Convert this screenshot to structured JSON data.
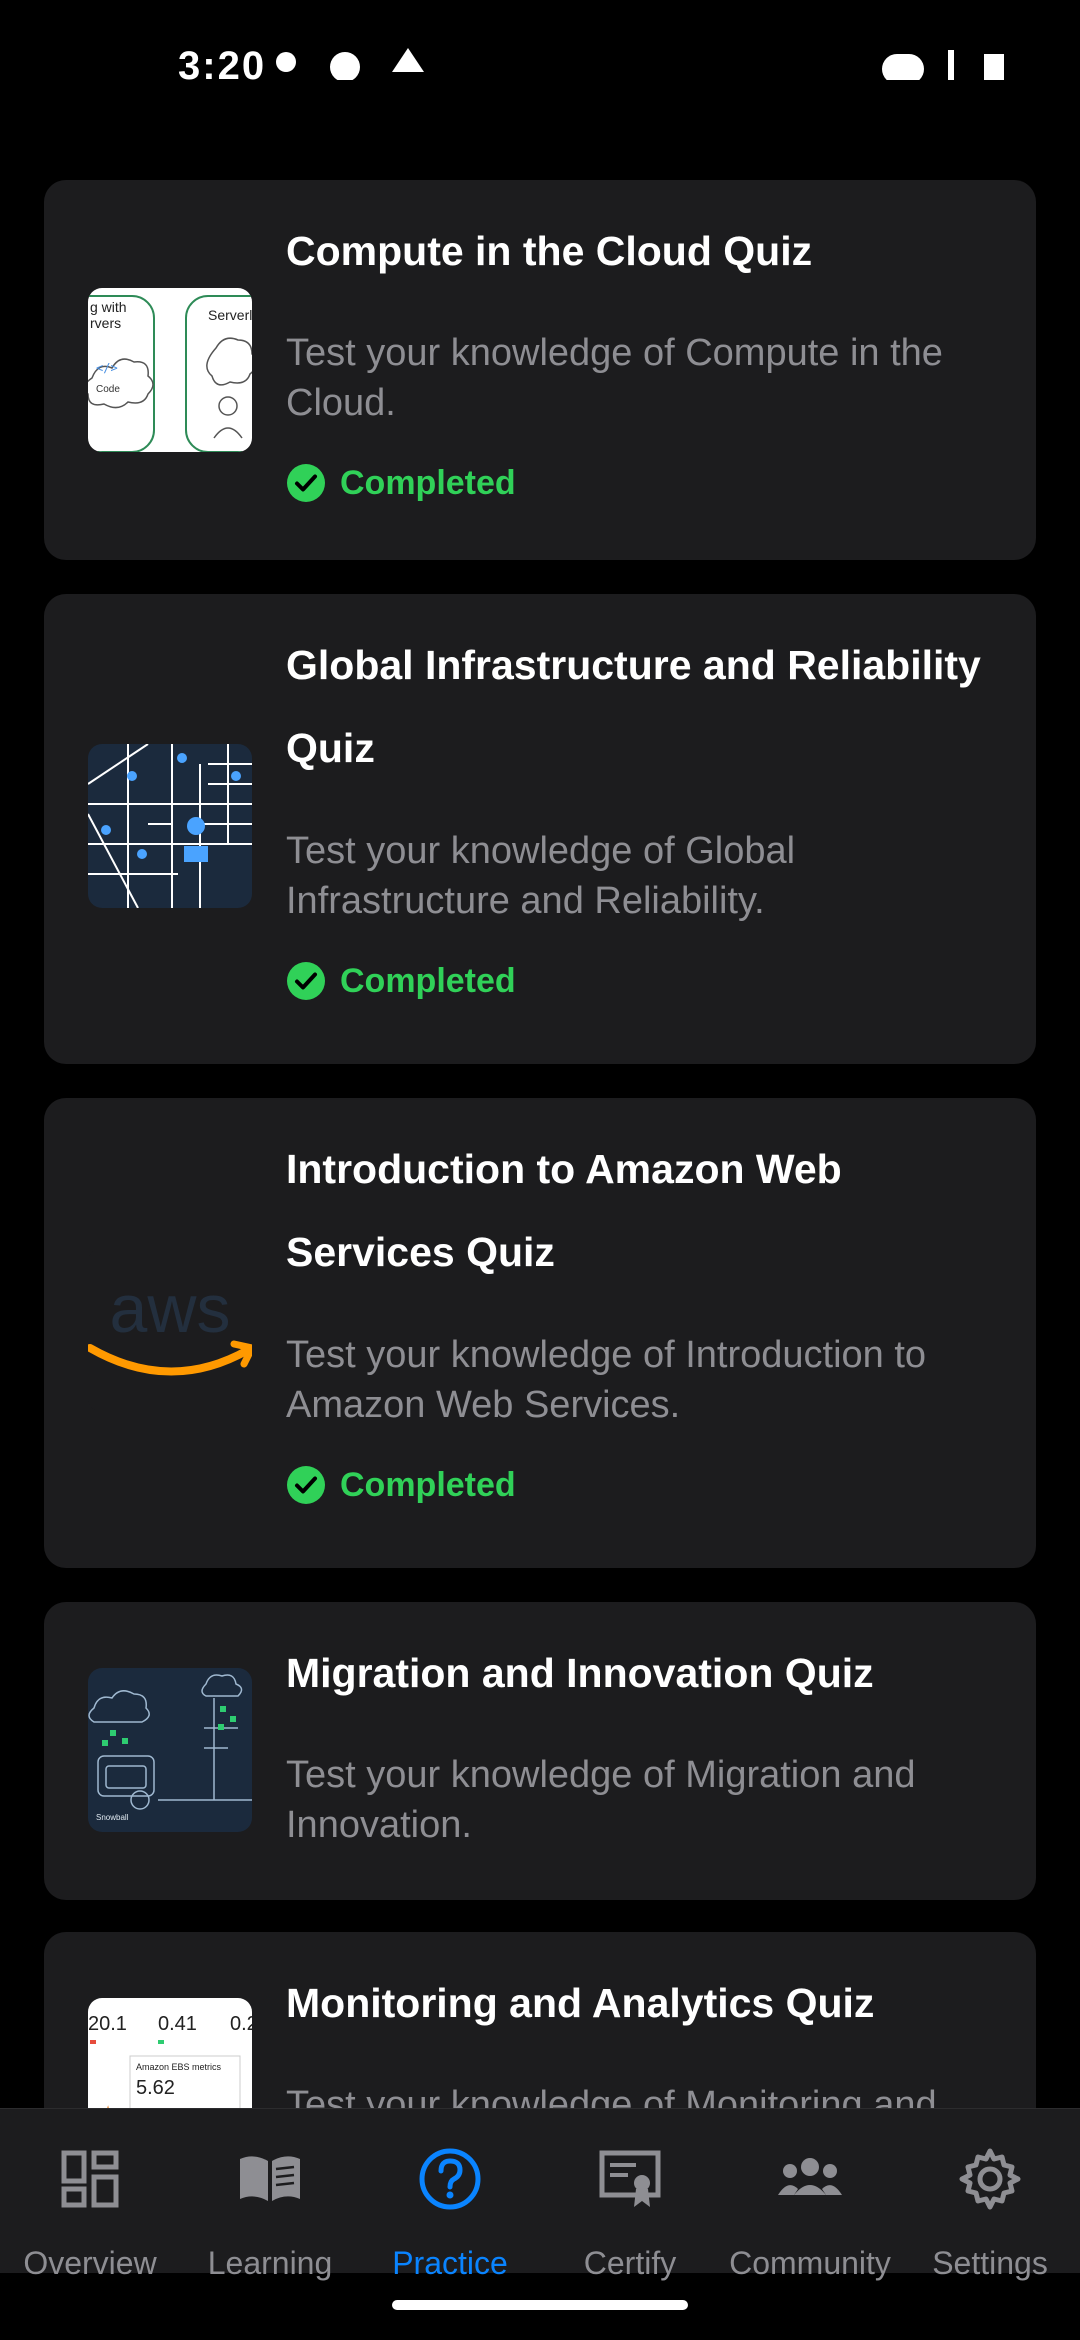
{
  "status_bar": {
    "time": "3:20"
  },
  "quizzes": [
    {
      "title": "Compute in the Cloud Quiz",
      "description": "Test your knowledge of Compute in the Cloud.",
      "status": "Completed",
      "thumb_text_1": "g with",
      "thumb_text_2": "rvers",
      "thumb_text_3": "Serverles",
      "thumb_text_4": "Code"
    },
    {
      "title": "Global Infrastructure and Reliability Quiz",
      "description": "Test your knowledge of Global Infrastructure and Reliability.",
      "status": "Completed"
    },
    {
      "title": "Introduction to Amazon Web Services Quiz",
      "description": "Test your knowledge of Introduction to Amazon Web Services.",
      "status": "Completed",
      "thumb_text_1": "aws"
    },
    {
      "title": "Migration and Innovation Quiz",
      "description": "Test your knowledge of Migration and Innovation.",
      "thumb_text_1": "Snowball"
    },
    {
      "title": "Monitoring and Analytics Quiz",
      "description": "Test your knowledge of Monitoring and Analytics.",
      "thumb_text_1": "20.1",
      "thumb_text_2": "0.41",
      "thumb_text_3": "0.2",
      "thumb_text_4": "Amazon EBS metrics",
      "thumb_text_5": "5.62"
    }
  ],
  "nav": {
    "items": [
      {
        "label": "Overview",
        "icon": "overview-icon"
      },
      {
        "label": "Learning",
        "icon": "book-icon"
      },
      {
        "label": "Practice",
        "icon": "question-icon"
      },
      {
        "label": "Certify",
        "icon": "certificate-icon"
      },
      {
        "label": "Community",
        "icon": "people-icon"
      },
      {
        "label": "Settings",
        "icon": "gear-icon"
      }
    ],
    "active_index": 2
  },
  "colors": {
    "background": "#000000",
    "card": "#1c1c1e",
    "completed_green": "#30d158",
    "accent_blue": "#0a84ff",
    "muted_text": "#8e8e93"
  }
}
